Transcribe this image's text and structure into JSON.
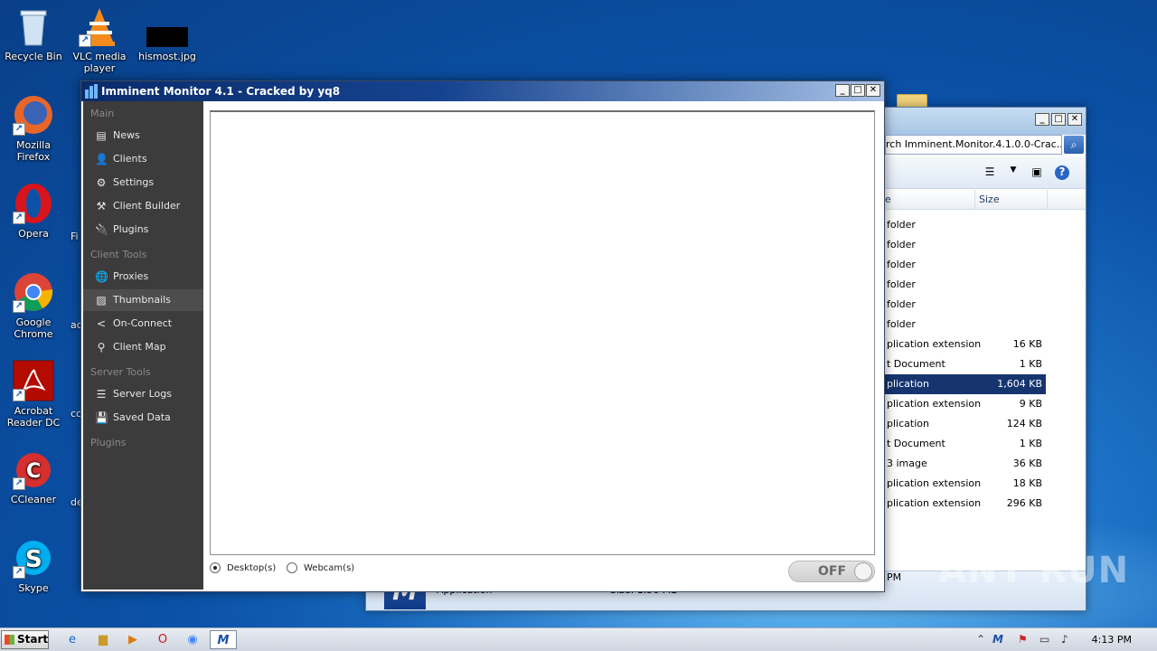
{
  "desktop": {
    "icons": [
      {
        "label": "Recycle Bin",
        "icon": "recycle-bin-icon"
      },
      {
        "label": "VLC media player",
        "icon": "vlc-icon"
      },
      {
        "label": "hismost.jpg",
        "icon": "image-file-icon"
      },
      {
        "label": "Mozilla Firefox",
        "icon": "firefox-icon"
      },
      {
        "label": "Opera",
        "icon": "opera-icon"
      },
      {
        "label": "Google Chrome",
        "icon": "chrome-icon"
      },
      {
        "label": "Acrobat Reader DC",
        "icon": "acrobat-icon"
      },
      {
        "label": "CCleaner",
        "icon": "ccleaner-icon"
      },
      {
        "label": "Skype",
        "icon": "skype-icon"
      }
    ],
    "partial_labels": [
      "Fi",
      "ac",
      "cc",
      "de"
    ]
  },
  "explorer": {
    "address": "rch Imminent.Monitor.4.1.0.0-Crac...",
    "columns": [
      "e",
      "Size"
    ],
    "rows": [
      {
        "type": "folder",
        "size": ""
      },
      {
        "type": "folder",
        "size": ""
      },
      {
        "type": "folder",
        "size": ""
      },
      {
        "type": "folder",
        "size": ""
      },
      {
        "type": "folder",
        "size": ""
      },
      {
        "type": "folder",
        "size": ""
      },
      {
        "type": "plication extension",
        "size": "16 KB"
      },
      {
        "type": "t Document",
        "size": "1 KB"
      },
      {
        "type": "plication",
        "size": "1,604 KB",
        "selected": true
      },
      {
        "type": "plication extension",
        "size": "9 KB"
      },
      {
        "type": "plication",
        "size": "124 KB"
      },
      {
        "type": "t Document",
        "size": "1 KB"
      },
      {
        "type": "3 image",
        "size": "36 KB"
      },
      {
        "type": "plication extension",
        "size": "18 KB"
      },
      {
        "type": "plication extension",
        "size": "296 KB"
      }
    ],
    "status": {
      "kind": "Application",
      "size": "Size: 1.56 MB",
      "time": "PM"
    }
  },
  "app": {
    "title": "Imminent Monitor 4.1 - Cracked by yq8",
    "sidebar": {
      "sections": [
        "Main",
        "Client Tools",
        "Server Tools",
        "Plugins"
      ],
      "main_items": [
        {
          "label": "News",
          "icon": "news-icon"
        },
        {
          "label": "Clients",
          "icon": "clients-icon"
        },
        {
          "label": "Settings",
          "icon": "gear-icon"
        },
        {
          "label": "Client Builder",
          "icon": "hammer-icon"
        },
        {
          "label": "Plugins",
          "icon": "plug-icon"
        }
      ],
      "client_tool_items": [
        {
          "label": "Proxies",
          "icon": "globe-icon"
        },
        {
          "label": "Thumbnails",
          "icon": "image-icon",
          "active": true
        },
        {
          "label": "On-Connect",
          "icon": "share-icon"
        },
        {
          "label": "Client Map",
          "icon": "map-pin-icon"
        }
      ],
      "server_tool_items": [
        {
          "label": "Server Logs",
          "icon": "logs-icon"
        },
        {
          "label": "Saved Data",
          "icon": "save-icon"
        }
      ]
    },
    "radios": [
      {
        "label": "Desktop(s)",
        "checked": true
      },
      {
        "label": "Webcam(s)",
        "checked": false
      }
    ],
    "toggle_label": "OFF"
  },
  "watermark": "ANY RUN",
  "taskbar": {
    "start_label": "Start",
    "clock": "4:13 PM"
  }
}
